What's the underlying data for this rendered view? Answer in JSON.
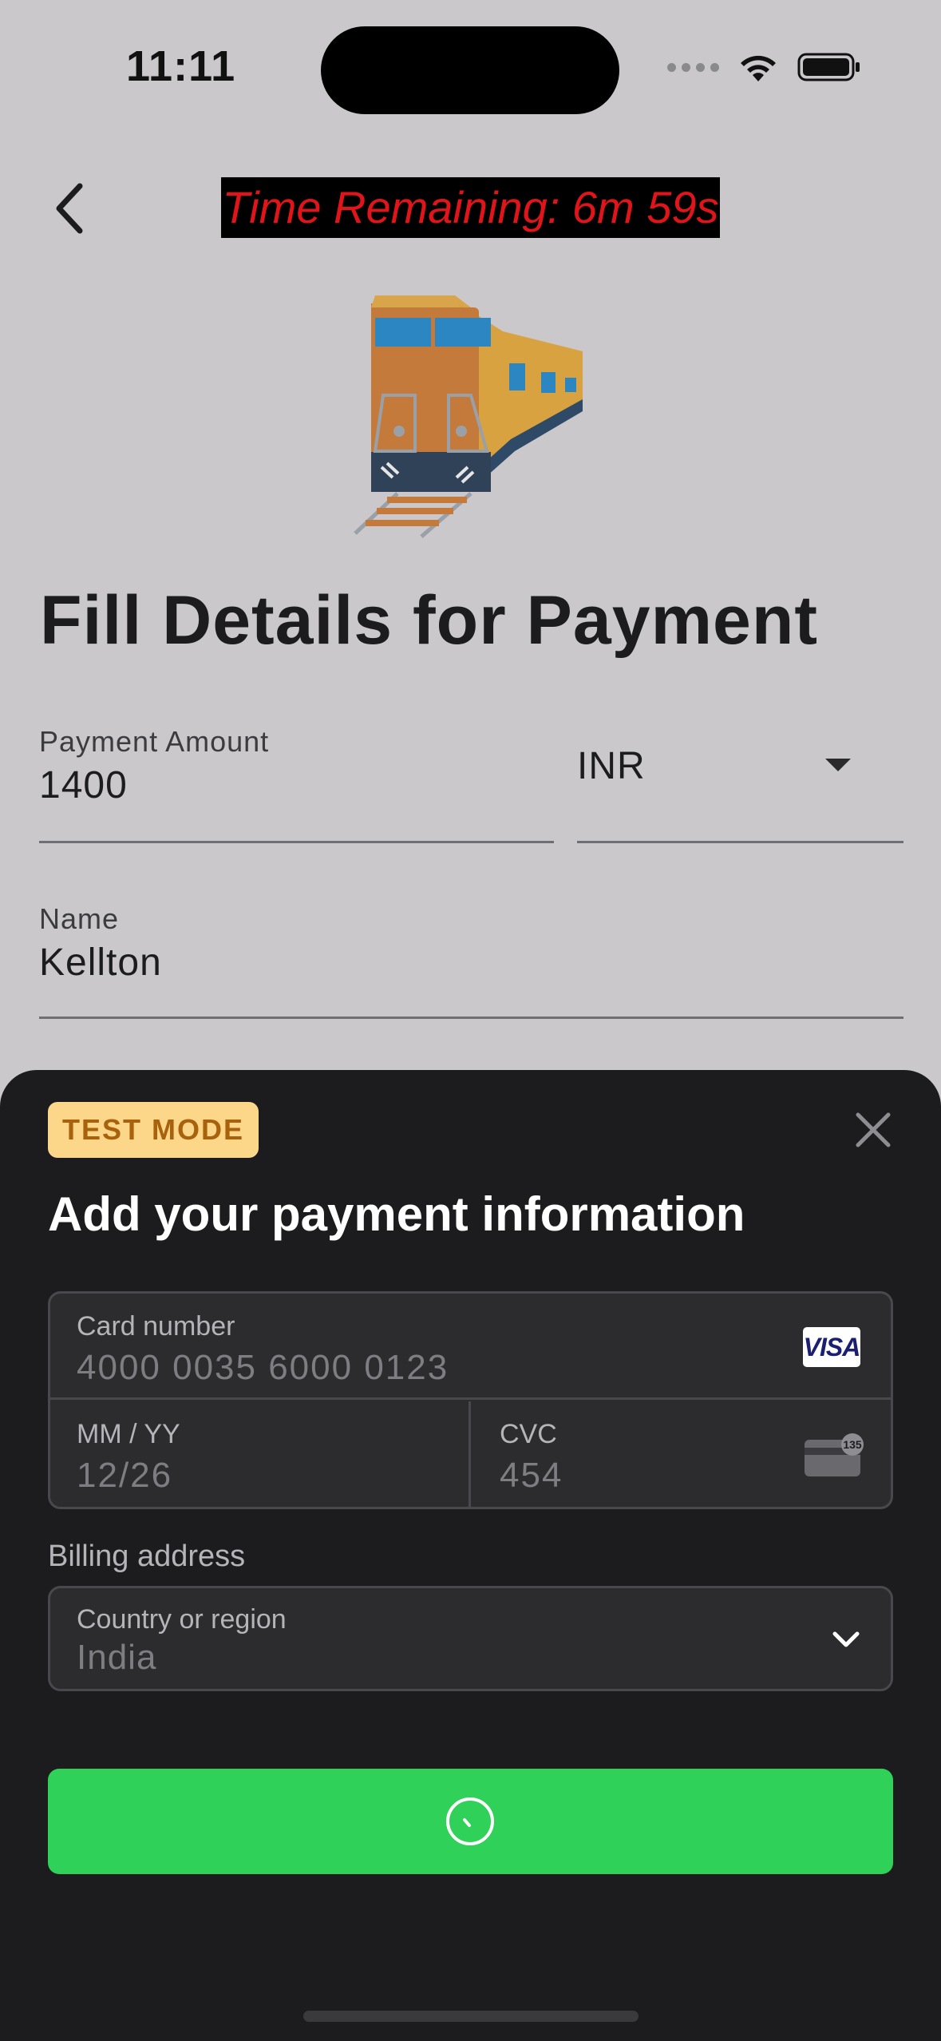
{
  "status_bar": {
    "time": "11:11"
  },
  "header": {
    "timer_text": "Time Remaining: 6m 59s"
  },
  "page": {
    "title": "Fill Details for Payment"
  },
  "form": {
    "amount_label": "Payment Amount",
    "amount_value": "1400",
    "currency_value": "INR",
    "name_label": "Name",
    "name_value": "Kellton"
  },
  "sheet": {
    "badge": "TEST MODE",
    "title": "Add your payment information",
    "card_number_label": "Card number",
    "card_number_value": "4000 0035 6000 0123",
    "card_brand": "VISA",
    "expiry_label": "MM / YY",
    "expiry_value": "12/26",
    "cvc_label": "CVC",
    "cvc_value": "454",
    "cvc_icon_text": "135",
    "billing_label": "Billing address",
    "country_label": "Country or region",
    "country_value": "India",
    "pay_button_state": "loading"
  },
  "colors": {
    "background": "#cac8cb",
    "timer_text": "#e1141a",
    "sheet_bg": "#1c1c1e",
    "badge_bg": "#fcd789",
    "badge_text": "#a8620d",
    "pay_button": "#30d158"
  },
  "icons": {
    "back": "chevron-left-icon",
    "close": "close-icon",
    "dropdown": "caret-down-icon",
    "country_dropdown": "chevron-down-icon",
    "spinner": "loading-spinner-icon",
    "train": "train-illustration"
  }
}
